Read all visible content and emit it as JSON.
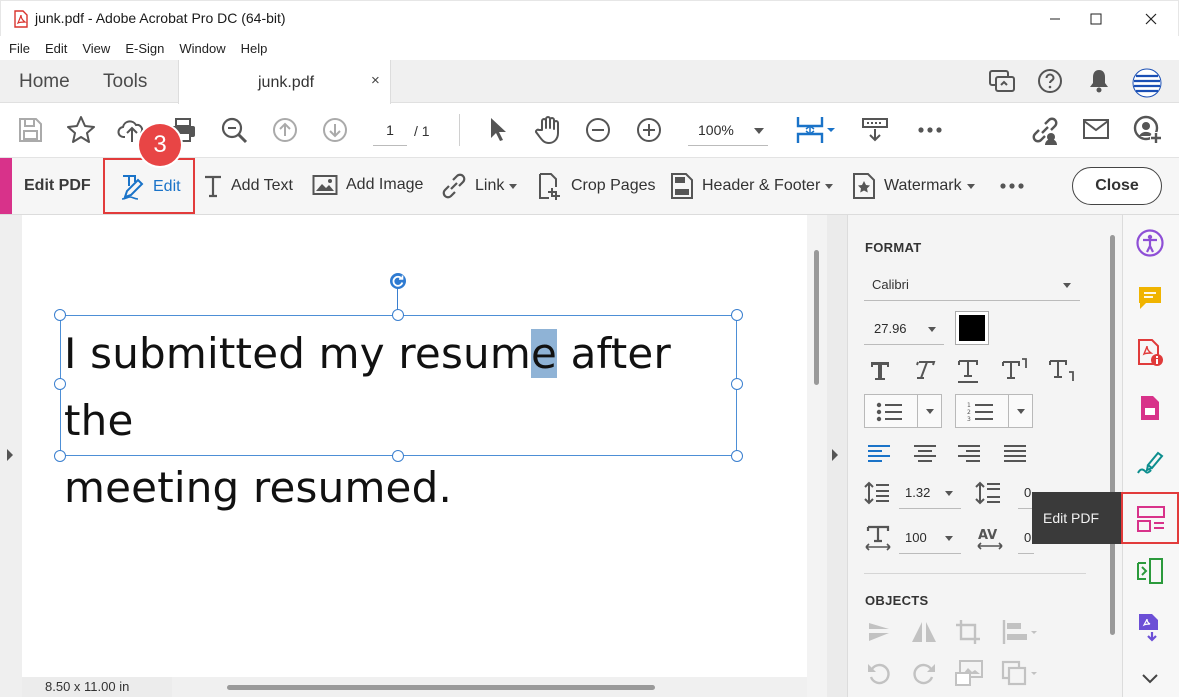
{
  "window": {
    "title": "junk.pdf - Adobe Acrobat Pro DC (64-bit)"
  },
  "menu": [
    "File",
    "Edit",
    "View",
    "E-Sign",
    "Window",
    "Help"
  ],
  "tabs": {
    "home": "Home",
    "tools": "Tools",
    "document": "junk.pdf",
    "close_symbol": "×"
  },
  "toolbar": {
    "page_current": "1",
    "page_total": "/ 1",
    "zoom": "100%"
  },
  "edit_toolbar": {
    "label": "Edit PDF",
    "edit": "Edit",
    "add_text": "Add Text",
    "add_image": "Add Image",
    "link": "Link",
    "crop_pages": "Crop Pages",
    "header_footer": "Header & Footer",
    "watermark": "Watermark",
    "close": "Close",
    "step_badge": "3"
  },
  "document": {
    "line1_before": "I submitted my resum",
    "line1_selected": "e",
    "line1_after": " after the",
    "line2": "meeting resumed.",
    "page_size": "8.50 x 11.00 in"
  },
  "format_panel": {
    "heading": "FORMAT",
    "font": "Calibri",
    "font_size": "27.96",
    "text_color": "#000000",
    "line_spacing": "1.32",
    "paragraph_spacing": "0",
    "horizontal_scale": "100",
    "char_spacing": "0",
    "objects_heading": "OBJECTS"
  },
  "right_rail": {
    "tooltip": "Edit PDF"
  },
  "colors": {
    "accent_pink": "#d8328a",
    "highlight_red": "#e23b3b",
    "link_blue": "#1a73c8",
    "selection": "#8fb3d6"
  }
}
